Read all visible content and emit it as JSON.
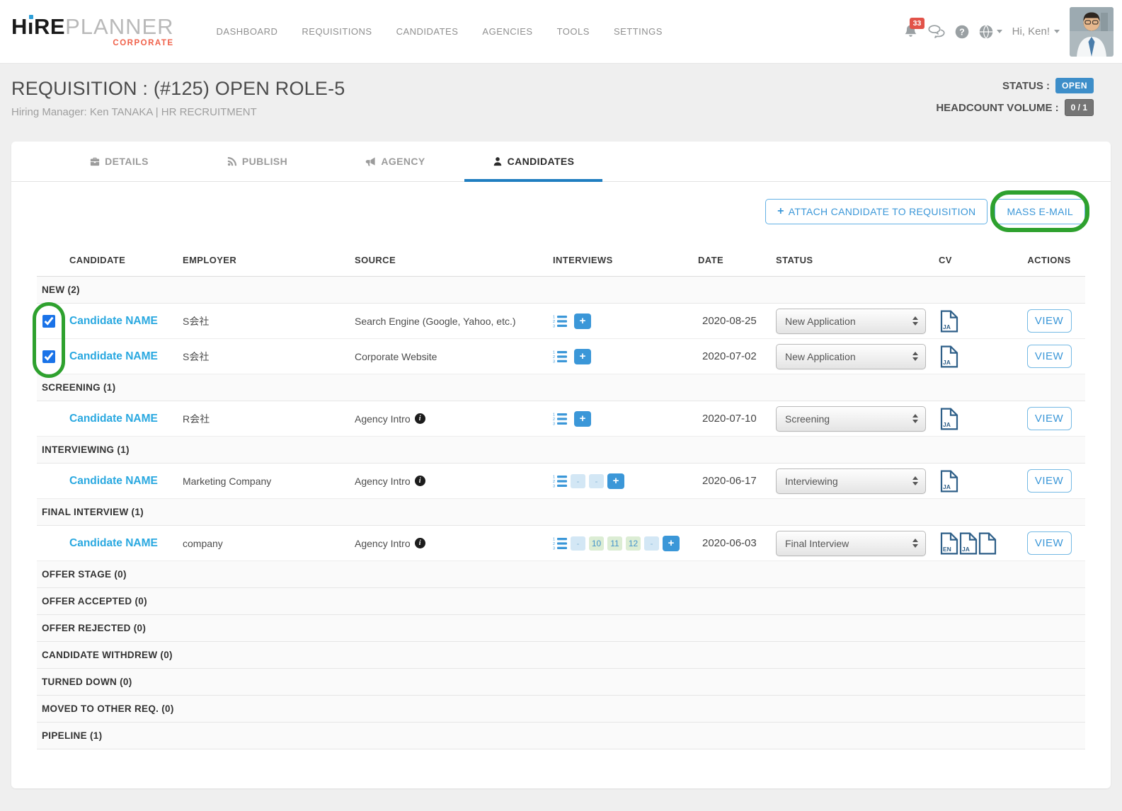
{
  "colors": {
    "accent_blue": "#3b97d8",
    "link_blue": "#29a8e0",
    "status_open_blue": "#3d8ec9",
    "annotation_green": "#2ea12e",
    "tab_active_underline": "#1f7ec0",
    "logo_orange": "#f0614a"
  },
  "icons": {
    "plus": "+",
    "info": "i"
  },
  "header": {
    "logo_h": "H",
    "logo_i": "ı",
    "logo_re": "RE",
    "logo_light": "PLANNER",
    "logo_sub": "CORPORATE",
    "nav": [
      "DASHBOARD",
      "REQUISITIONS",
      "CANDIDATES",
      "AGENCIES",
      "TOOLS",
      "SETTINGS"
    ],
    "notifications_count": "33",
    "greeting": "Hi, Ken!"
  },
  "requisition": {
    "title": "REQUISITION : (#125) OPEN ROLE-5",
    "subtitle": "Hiring Manager: Ken TANAKA | HR RECRUITMENT",
    "status_label": "STATUS :",
    "status_value": "OPEN",
    "headcount_label": "HEADCOUNT VOLUME :",
    "headcount_value": "0 / 1"
  },
  "tabs": [
    {
      "label": "DETAILS"
    },
    {
      "label": "PUBLISH"
    },
    {
      "label": "AGENCY"
    },
    {
      "label": "CANDIDATES"
    }
  ],
  "toolbar": {
    "attach_label": "ATTACH CANDIDATE TO REQUISITION",
    "mass_email_label": "MASS E-MAIL"
  },
  "table": {
    "columns": [
      "CANDIDATE",
      "EMPLOYER",
      "SOURCE",
      "INTERVIEWS",
      "DATE",
      "STATUS",
      "CV",
      "ACTIONS"
    ],
    "view_label": "VIEW",
    "sections": [
      {
        "label": "NEW (2)",
        "rows": [
          {
            "checked": true,
            "name": "Candidate NAME",
            "employer": "S会社",
            "source": "Search Engine (Google, Yahoo, etc.)",
            "source_info": false,
            "interviews": [],
            "date": "2020-08-25",
            "status": "New Application",
            "cv": [
              "JA"
            ]
          },
          {
            "checked": true,
            "name": "Candidate NAME",
            "employer": "S会社",
            "source": "Corporate Website",
            "source_info": false,
            "interviews": [],
            "date": "2020-07-02",
            "status": "New Application",
            "cv": [
              "JA"
            ]
          }
        ]
      },
      {
        "label": "SCREENING (1)",
        "rows": [
          {
            "name": "Candidate NAME",
            "employer": "R会社",
            "source": "Agency Intro",
            "source_info": true,
            "interviews": [],
            "date": "2020-07-10",
            "status": "Screening",
            "cv": [
              "JA"
            ]
          }
        ]
      },
      {
        "label": "INTERVIEWING (1)",
        "rows": [
          {
            "name": "Candidate NAME",
            "employer": "Marketing Company",
            "source": "Agency Intro",
            "source_info": true,
            "interviews": [
              "-",
              "-"
            ],
            "date": "2020-06-17",
            "status": "Interviewing",
            "cv": [
              "JA"
            ]
          }
        ]
      },
      {
        "label": "FINAL INTERVIEW (1)",
        "rows": [
          {
            "name": "Candidate NAME",
            "employer": "company",
            "source": "Agency Intro",
            "source_info": true,
            "interviews": [
              "-",
              "10",
              "11",
              "12",
              "-"
            ],
            "date": "2020-06-03",
            "status": "Final Interview",
            "cv": [
              "EN",
              "JA",
              ""
            ]
          }
        ]
      },
      {
        "label": "OFFER STAGE (0)",
        "rows": []
      },
      {
        "label": "OFFER ACCEPTED (0)",
        "rows": []
      },
      {
        "label": "OFFER REJECTED (0)",
        "rows": []
      },
      {
        "label": "CANDIDATE WITHDREW (0)",
        "rows": []
      },
      {
        "label": "TURNED DOWN (0)",
        "rows": []
      },
      {
        "label": "MOVED TO OTHER REQ. (0)",
        "rows": []
      },
      {
        "label": "PIPELINE (1)",
        "rows": []
      }
    ]
  }
}
